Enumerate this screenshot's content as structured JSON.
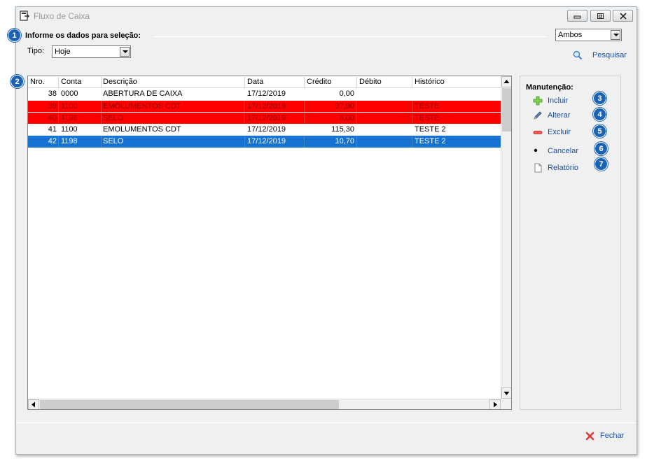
{
  "window": {
    "title": "Fluxo de Caixa"
  },
  "selection": {
    "header": "Informe os dados para seleção:",
    "tipo_label": "Tipo:",
    "tipo_value": "Hoje",
    "filter_value": "Ambos",
    "search_label": "Pesquisar"
  },
  "badges": [
    "1",
    "2",
    "3",
    "4",
    "5",
    "6",
    "7"
  ],
  "grid": {
    "columns": [
      "Nro.",
      "Conta",
      "Descrição",
      "Data",
      "Crédito",
      "Débito",
      "Histórico"
    ],
    "rows": [
      {
        "nro": "38",
        "conta": "0000",
        "descricao": "ABERTURA DE CAIXA",
        "data": "17/12/2019",
        "credito": "0,00",
        "debito": "",
        "historico": "",
        "style": "normal"
      },
      {
        "nro": "39",
        "conta": "1100",
        "descricao": "EMOLUMENTOS CDT",
        "data": "17/12/2019",
        "credito": "97,90",
        "debito": "",
        "historico": "TESTE",
        "style": "red"
      },
      {
        "nro": "40",
        "conta": "1198",
        "descricao": "SELO",
        "data": "17/12/2019",
        "credito": "8,00",
        "debito": "",
        "historico": "TESTE",
        "style": "red"
      },
      {
        "nro": "41",
        "conta": "1100",
        "descricao": "EMOLUMENTOS CDT",
        "data": "17/12/2019",
        "credito": "115,30",
        "debito": "",
        "historico": "TESTE 2",
        "style": "normal"
      },
      {
        "nro": "42",
        "conta": "1198",
        "descricao": "SELO",
        "data": "17/12/2019",
        "credito": "10,70",
        "debito": "",
        "historico": "TESTE 2",
        "style": "selected"
      }
    ]
  },
  "maintenance": {
    "title": "Manutenção:",
    "actions": [
      {
        "label": "Incluir",
        "icon": "plus-icon"
      },
      {
        "label": "Alterar",
        "icon": "pencil-icon"
      },
      {
        "label": "Excluir",
        "icon": "minus-icon"
      },
      {
        "label": "Cancelar",
        "icon": "dot-icon"
      },
      {
        "label": "Relatório",
        "icon": "document-icon"
      }
    ]
  },
  "footer": {
    "close_label": "Fechar"
  },
  "colors": {
    "accent": "#1d63b5",
    "row_red": "#ff0000",
    "row_selected": "#1673d1",
    "link": "#1b4f9a"
  }
}
